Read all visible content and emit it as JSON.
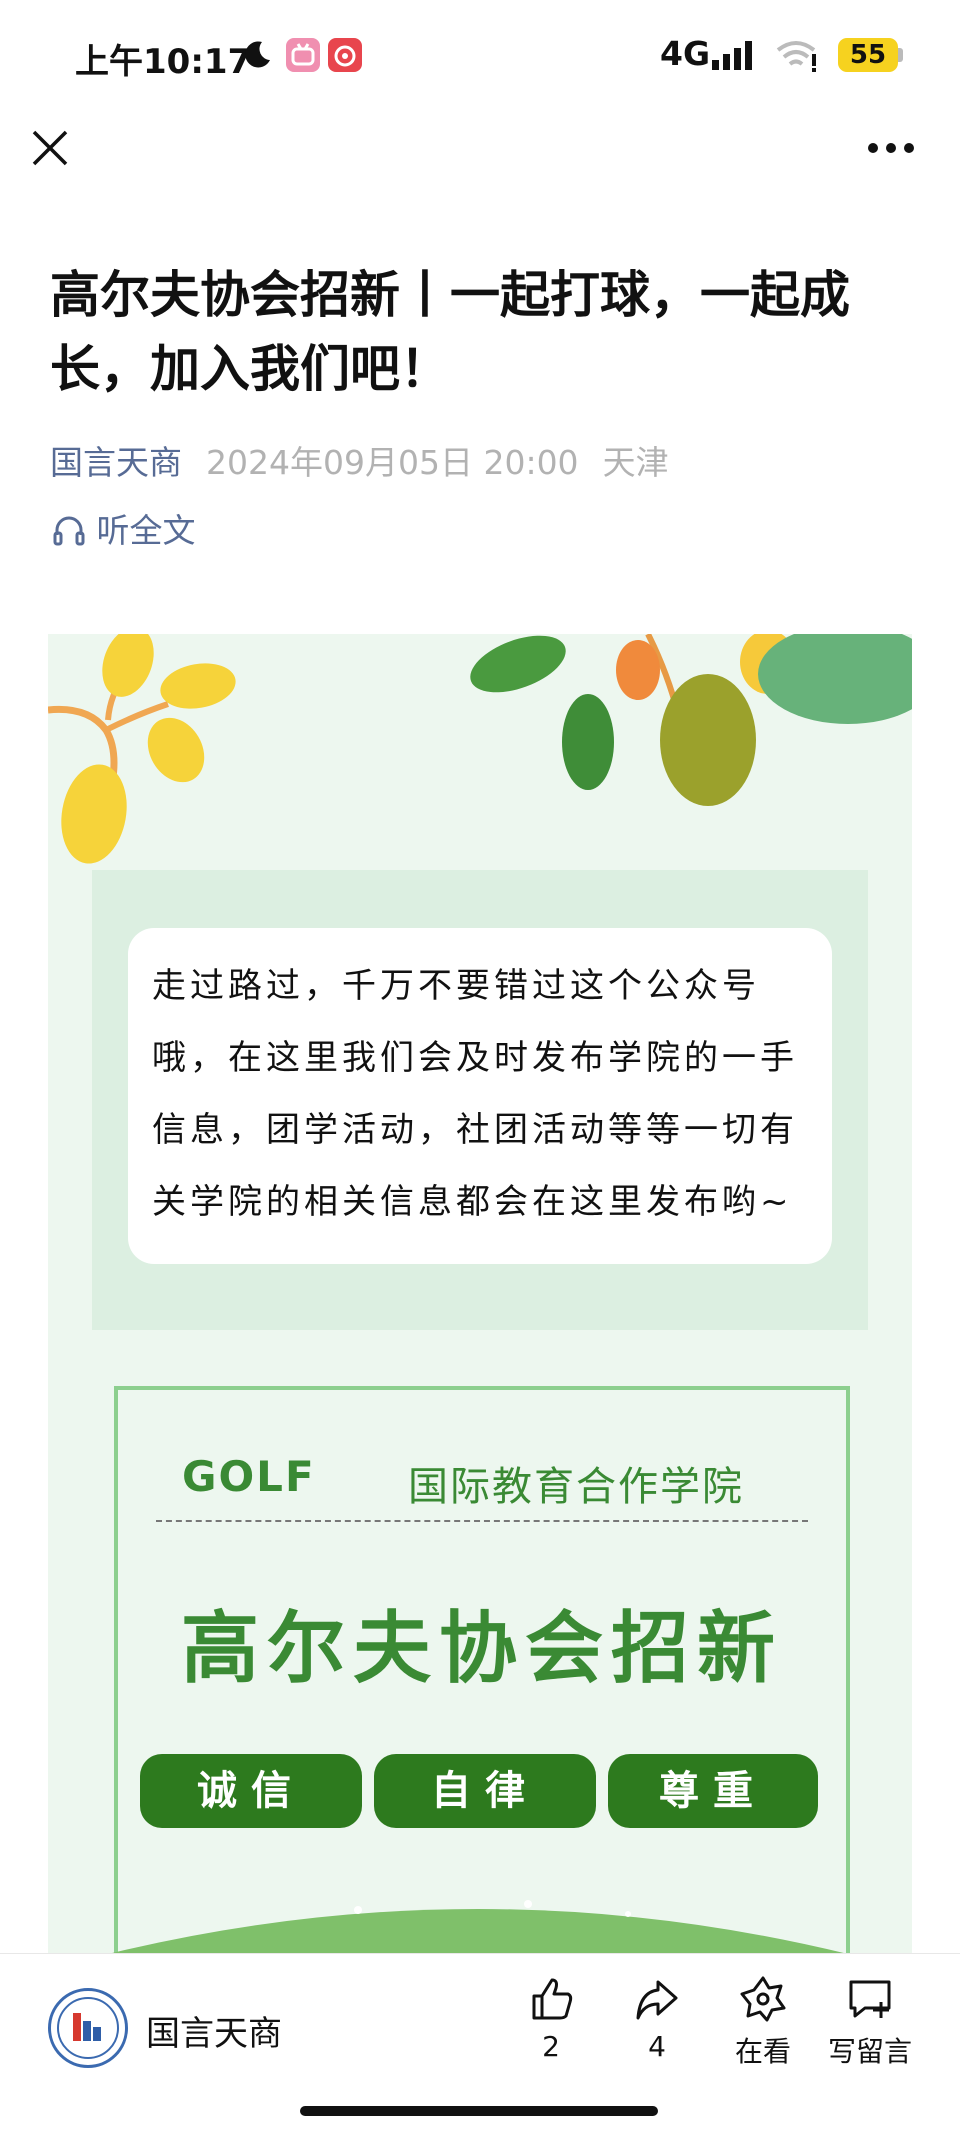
{
  "status_bar": {
    "time": "上午10:17",
    "network": "4G",
    "battery": "55",
    "signal_strength_bars": 4,
    "battery_level_percent": 55
  },
  "nav": {
    "close_icon": "close-icon",
    "more_icon": "more-icon"
  },
  "article": {
    "title": "高尔夫协会招新丨一起打球，一起成长，加入我们吧！",
    "account": "国言天商",
    "date": "2024年09月05日 20:00",
    "location": "天津",
    "listen_label": "听全文"
  },
  "poster": {
    "intro": "走过路过，千万不要错过这个公众号哦，在这里我们会及时发布学院的一手信息，团学活动，社团活动等等一切有关学院的相关信息都会在这里发布哟~",
    "golf_label": "GOLF",
    "college": "国际教育合作学院",
    "headline": "高尔夫协会招新",
    "values": [
      "诚信",
      "自律",
      "尊重"
    ]
  },
  "bottom_bar": {
    "account": "国言天商",
    "like_count": "2",
    "share_count": "4",
    "watching_label": "在看",
    "comment_label": "写留言"
  },
  "colors": {
    "link_blue": "#576b95",
    "poster_green": "#3a8a34",
    "pill_green": "#2d7a1e",
    "poster_bg": "#edf7ef",
    "battery_yellow": "#f6d21f"
  }
}
